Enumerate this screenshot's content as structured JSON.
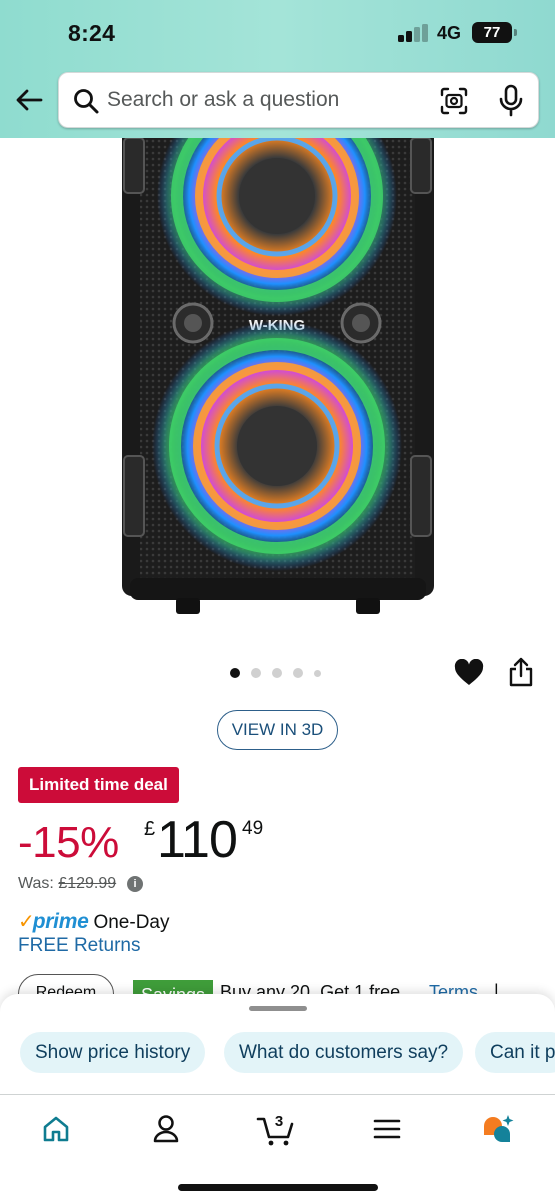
{
  "status_bar": {
    "time": "8:24",
    "network": "4G",
    "battery": "77"
  },
  "header": {
    "search_placeholder": "Search or ask a question"
  },
  "product": {
    "brand_on_image": "W-KING",
    "image_page_count": 5,
    "image_page_active": 1
  },
  "actions": {
    "view_3d_label": "VIEW IN 3D"
  },
  "pricing": {
    "deal_badge": "Limited time deal",
    "discount": "-15%",
    "currency": "£",
    "price_whole": "110",
    "price_fraction": "49",
    "was_label": "Was:",
    "was_price": "£129.99",
    "info_glyph": "i"
  },
  "delivery": {
    "prime_check": "✓",
    "prime_word": "prime",
    "prime_speed": "One-Day",
    "returns": "FREE Returns"
  },
  "offers_row": {
    "redeem_label": "Redeem",
    "savings_badge": "Savings",
    "offer_text": "Buy any 20, Get 1 free",
    "terms_link": "Terms",
    "separator": "|"
  },
  "suggestions": {
    "chips": [
      "Show price history",
      "What do customers say?",
      "Can it p"
    ]
  },
  "bottom_nav": {
    "cart_count": "3",
    "active": "home"
  },
  "colors": {
    "header_gradient": "#9ee0d4",
    "deal_red": "#cc0c39",
    "link_blue": "#1f6aa5",
    "prime_blue": "#1f8fd3",
    "prime_orange": "#f79400",
    "nav_active": "#0f7c90",
    "chip_bg": "#e3f4f8",
    "savings_green": "#3f9d3a"
  }
}
